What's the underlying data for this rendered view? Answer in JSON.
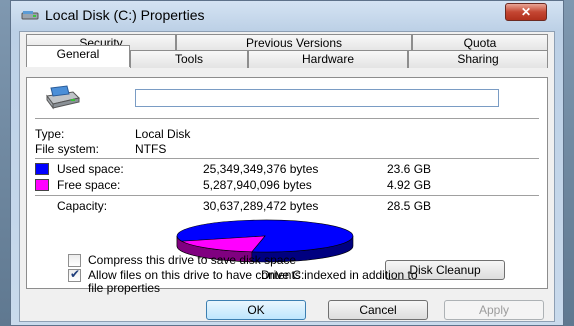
{
  "window": {
    "title": "Local Disk (C:) Properties",
    "close": "✕"
  },
  "tabs": {
    "row1": [
      "Security",
      "Previous Versions",
      "Quota"
    ],
    "row2": [
      "General",
      "Tools",
      "Hardware",
      "Sharing"
    ],
    "active": "General"
  },
  "general": {
    "name_value": "",
    "type_label": "Type:",
    "type_value": "Local Disk",
    "fs_label": "File system:",
    "fs_value": "NTFS",
    "used": {
      "label": "Used space:",
      "bytes": "25,349,349,376 bytes",
      "size": "23.6 GB",
      "color": "#0000ff"
    },
    "free": {
      "label": "Free space:",
      "bytes": "5,287,940,096 bytes",
      "size": "4.92 GB",
      "color": "#ff00ff"
    },
    "capacity": {
      "label": "Capacity:",
      "bytes": "30,637,289,472 bytes",
      "size": "28.5 GB"
    },
    "used_fraction": 0.827,
    "drive_label": "Drive C:",
    "cleanup_button": "Disk Cleanup"
  },
  "options": {
    "compress": {
      "label": "Compress this drive to save disk space",
      "checked": false
    },
    "index_line1": "Allow files on this drive to have contents indexed in addition to",
    "index_line2": "file properties",
    "index_checked": true
  },
  "buttons": {
    "ok": "OK",
    "cancel": "Cancel",
    "apply": "Apply"
  },
  "icons": {
    "title": "drive-icon",
    "drive": "hard-drive-icon"
  }
}
